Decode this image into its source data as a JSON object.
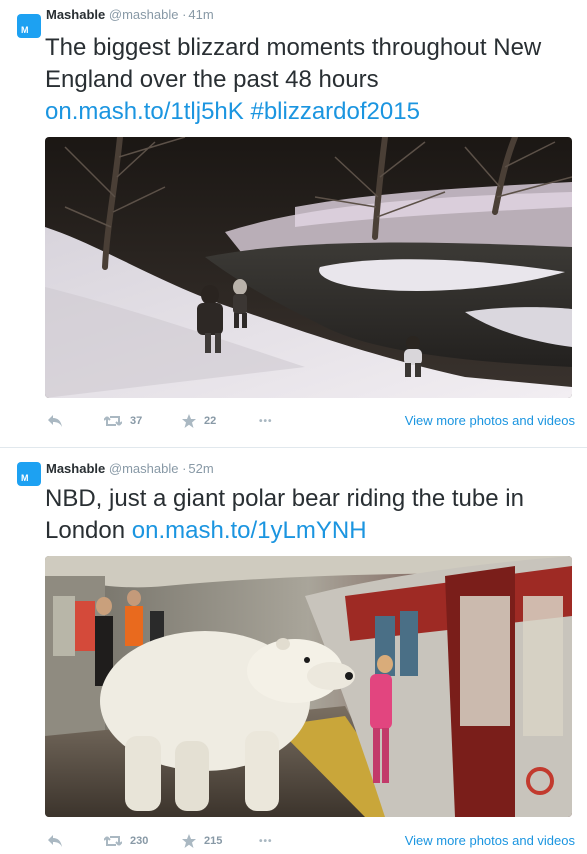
{
  "tweets": [
    {
      "avatar_letter": "M",
      "name": "Mashable",
      "handle": "@mashable",
      "separator": "·",
      "time": "41m",
      "text": "The biggest blizzard moments throughout New England over the past 48 hours",
      "link_1": "on.mash.to/1tlj5hK",
      "link_2": "#blizzardof2015",
      "image_alt": "Children playing in snow in a park at night beside a frozen pond",
      "retweets": "37",
      "favorites": "22",
      "more_label": "•••",
      "view_more": "View more photos and videos"
    },
    {
      "avatar_letter": "M",
      "name": "Mashable",
      "handle": "@mashable",
      "separator": "·",
      "time": "52m",
      "text": "NBD, just a giant polar bear riding the tube in London",
      "link_1": "on.mash.to/1yLmYNH",
      "link_2": "",
      "image_alt": "Polar bear standing on a London Underground platform next to a train and a girl in pink",
      "retweets": "230",
      "favorites": "215",
      "more_label": "•••",
      "view_more": "View more photos and videos"
    }
  ],
  "colors": {
    "link": "#1b95e0",
    "meta": "#8899a6",
    "text": "#292f33",
    "avatar_bg": "#1da1f2",
    "divider": "#e1e8ed"
  },
  "icons": [
    "reply-icon",
    "retweet-icon",
    "favorite-icon",
    "more-icon"
  ]
}
